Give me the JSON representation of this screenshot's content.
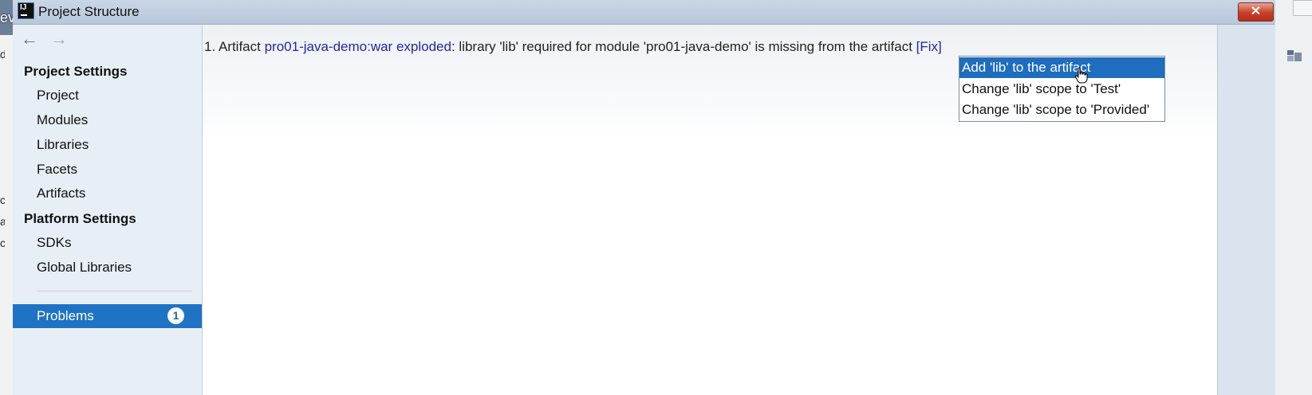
{
  "background": {
    "preview_text": "eview",
    "left_fragments": [
      "d",
      "c",
      "a",
      "c"
    ]
  },
  "window": {
    "title": "Project Structure",
    "icon_text": "IJ",
    "close_glyph": "✕"
  },
  "nav": {
    "back_glyph": "←",
    "forward_glyph": "→"
  },
  "sidebar": {
    "project_settings": {
      "heading": "Project Settings",
      "items": [
        "Project",
        "Modules",
        "Libraries",
        "Facets",
        "Artifacts"
      ]
    },
    "platform_settings": {
      "heading": "Platform Settings",
      "items": [
        "SDKs",
        "Global Libraries"
      ]
    },
    "problems": {
      "label": "Problems",
      "count": "1"
    }
  },
  "content": {
    "problem": {
      "prefix": "1. Artifact ",
      "artifact_link": "pro01-java-demo:war exploded",
      "message": ": library 'lib' required for module 'pro01-java-demo' is missing from the artifact ",
      "fix_link": "[Fix]"
    },
    "fix_popup": {
      "items": [
        "Add 'lib' to the artifact",
        "Change 'lib' scope to 'Test'",
        "Change 'lib' scope to 'Provided'"
      ],
      "selected_index": 0
    }
  },
  "colors": {
    "selection": "#1e73c5",
    "link": "#2326a8",
    "close_button": "#c8402a"
  }
}
